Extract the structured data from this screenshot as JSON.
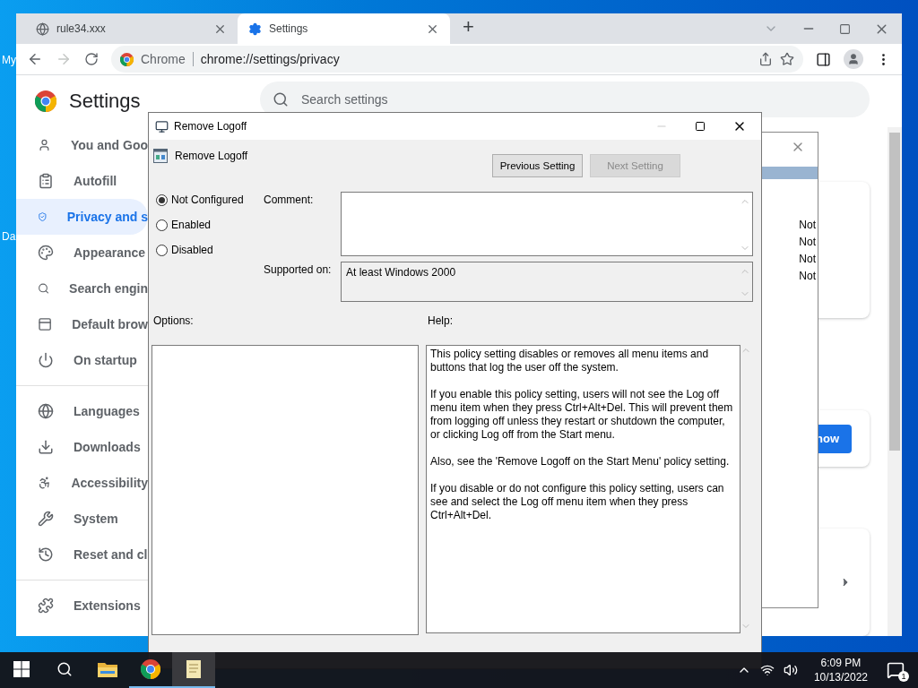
{
  "desktop": {
    "icon_labels": [
      "My",
      "Da"
    ]
  },
  "browser": {
    "tabs": [
      {
        "title": "rule34.xxx",
        "kind": "globe",
        "selected": false
      },
      {
        "title": "Settings",
        "kind": "gear",
        "selected": true
      }
    ],
    "new_tab": "+",
    "forward_disabled": true,
    "address": {
      "chip": "Chrome",
      "url": "chrome://settings/privacy"
    }
  },
  "settings": {
    "title": "Settings",
    "search_placeholder": "Search settings",
    "nav_groups": [
      [
        {
          "label": "You and Goo",
          "kind": "person",
          "selected": false
        },
        {
          "label": "Autofill",
          "kind": "clipboard",
          "selected": false
        },
        {
          "label": "Privacy and s",
          "kind": "shield",
          "selected": true
        },
        {
          "label": "Appearance",
          "kind": "palette",
          "selected": false
        },
        {
          "label": "Search engin",
          "kind": "search",
          "selected": false
        },
        {
          "label": "Default brow",
          "kind": "browser",
          "selected": false
        },
        {
          "label": "On startup",
          "kind": "power",
          "selected": false
        }
      ],
      [
        {
          "label": "Languages",
          "kind": "globe",
          "selected": false
        },
        {
          "label": "Downloads",
          "kind": "download",
          "selected": false
        },
        {
          "label": "Accessibility",
          "kind": "accessibility",
          "selected": false
        },
        {
          "label": "System",
          "kind": "wrench",
          "selected": false
        },
        {
          "label": "Reset and cl",
          "kind": "reset",
          "selected": false
        }
      ],
      [
        {
          "label": "Extensions",
          "kind": "puzzle",
          "selected": false
        }
      ]
    ],
    "action_button": "now"
  },
  "background_window": {
    "rows": [
      "Not",
      "Not",
      "Not",
      "Not"
    ]
  },
  "dialog": {
    "title": "Remove Logoff",
    "setting_name": "Remove Logoff",
    "nav_buttons": [
      {
        "label": "Previous Setting",
        "disabled": false
      },
      {
        "label": "Next Setting",
        "disabled": true
      }
    ],
    "states": [
      {
        "label": "Not Configured",
        "selected": true
      },
      {
        "label": "Enabled",
        "selected": false
      },
      {
        "label": "Disabled",
        "selected": false
      }
    ],
    "comment_label": "Comment:",
    "supported_label": "Supported on:",
    "supported_value": "At least Windows 2000",
    "options_label": "Options:",
    "help_label": "Help:",
    "help": [
      "This policy setting disables or removes all menu items and buttons that log the user off the system.",
      "If you enable this policy setting, users will not see the Log off menu item when they press Ctrl+Alt+Del. This will prevent them from logging off unless they restart or shutdown the computer, or clicking Log off from the Start menu.",
      "Also, see the 'Remove Logoff on the Start Menu' policy setting.",
      "If you disable or do not configure this policy setting, users can see and select the Log off menu item when they press Ctrl+Alt+Del."
    ]
  },
  "taskbar": {
    "apps": [
      {
        "kind": "folder",
        "running": false,
        "selected": false
      },
      {
        "kind": "chrome",
        "running": true,
        "selected": false
      },
      {
        "kind": "notepad",
        "running": true,
        "selected": true
      }
    ],
    "time": "6:09 PM",
    "date": "10/13/2022",
    "notifications": "1"
  }
}
